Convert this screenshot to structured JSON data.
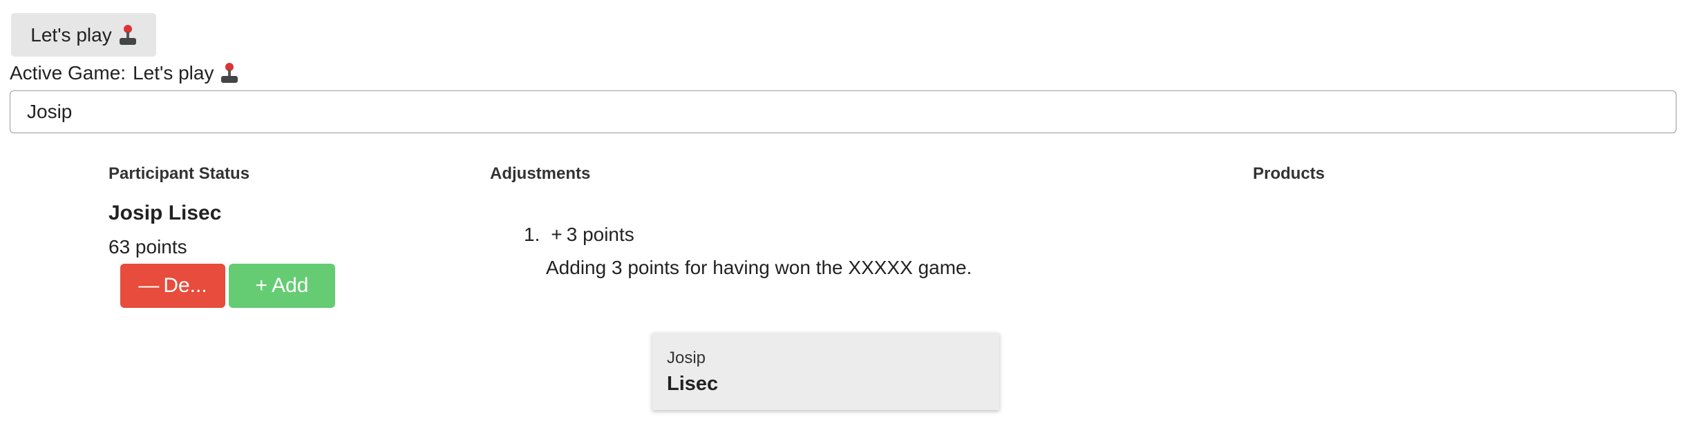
{
  "game_button": {
    "label": "Let's play",
    "icon": "joystick-icon"
  },
  "active_game": {
    "label": "Active Game:",
    "name": "Let's play",
    "icon": "joystick-icon"
  },
  "search": {
    "value": "Josip"
  },
  "columns": {
    "participant_status": "Participant Status",
    "adjustments": "Adjustments",
    "products": "Products"
  },
  "participant": {
    "name": "Josip Lisec",
    "points": "63 points"
  },
  "actions": {
    "deduct_label": "De...",
    "add_label": "Add",
    "deduct_color": "#e74c3c",
    "add_color": "#65cc74"
  },
  "adjustments": [
    {
      "index": "1.",
      "amount": "3 points",
      "description": "Adding 3 points for having won the XXXXX game."
    }
  ],
  "card": {
    "first_name": "Josip",
    "last_name": "Lisec"
  }
}
